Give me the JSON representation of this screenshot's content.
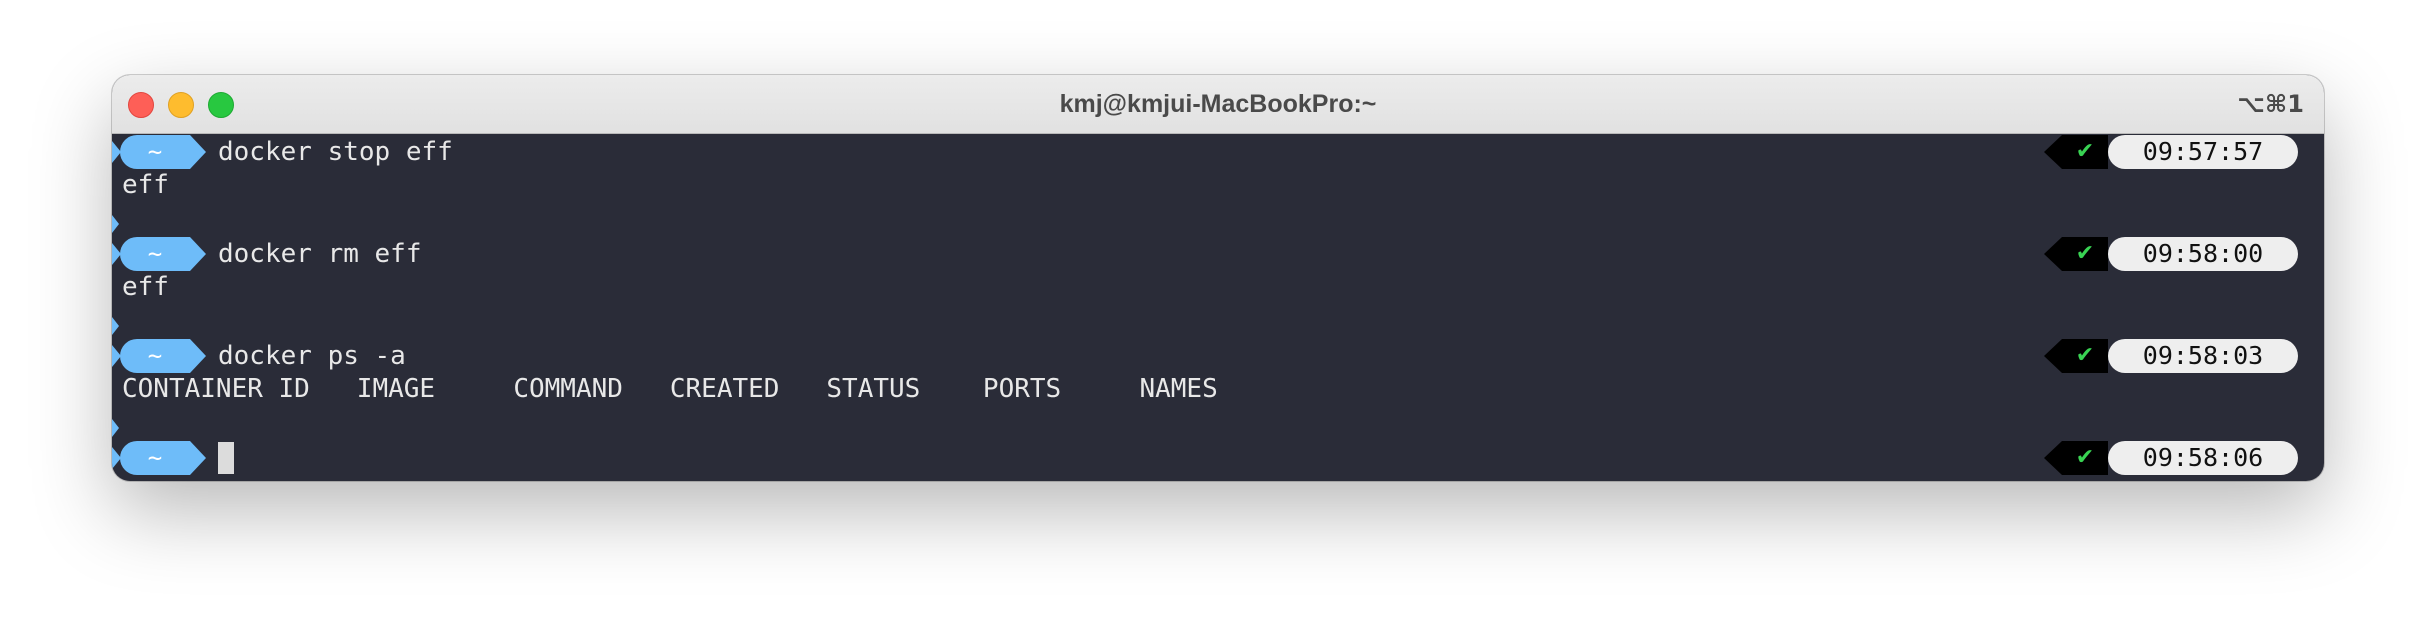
{
  "window": {
    "title": "kmj@kmjui-MacBookPro:~",
    "shortcut": "⌥⌘1"
  },
  "colors": {
    "terminal_bg": "#2a2c38",
    "prompt_segment": "#6ebcf9",
    "status_ok": "#39d353",
    "time_pill": "#eeeeee"
  },
  "prompts": [
    {
      "dir": "~",
      "command": "docker stop eff",
      "status": "✔",
      "time": "09:57:57"
    },
    {
      "dir": "~",
      "command": "docker rm eff",
      "status": "✔",
      "time": "09:58:00"
    },
    {
      "dir": "~",
      "command": "docker ps -a",
      "status": "✔",
      "time": "09:58:03"
    },
    {
      "dir": "~",
      "command": "",
      "status": "✔",
      "time": "09:58:06"
    }
  ],
  "outputs": [
    "eff",
    "eff",
    "CONTAINER ID   IMAGE     COMMAND   CREATED   STATUS    PORTS     NAMES"
  ]
}
